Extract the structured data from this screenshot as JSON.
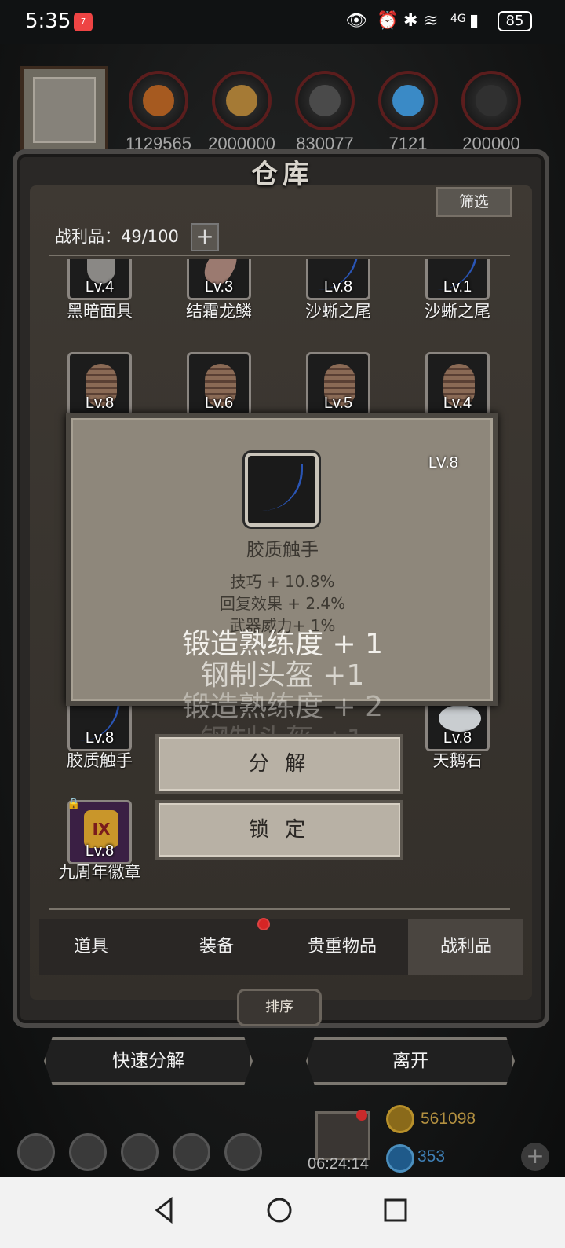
{
  "status_bar": {
    "time": "5:35",
    "app_badge": "7",
    "battery": "85",
    "signal": "4G"
  },
  "resources": {
    "values": [
      "1129565",
      "2000000",
      "830077",
      "7121",
      "200000"
    ]
  },
  "window": {
    "title": "仓库",
    "filter_label": "筛选",
    "loot_count": "战利品：49/100"
  },
  "items_row1": [
    {
      "level": "Lv.4",
      "name": "黑暗面具",
      "icon": "mask-icon"
    },
    {
      "level": "Lv.3",
      "name": "结霜龙鳞",
      "icon": "scale-icon"
    },
    {
      "level": "Lv.8",
      "name": "沙蜥之尾",
      "icon": "tail-icon"
    },
    {
      "level": "Lv.1",
      "name": "沙蜥之尾",
      "icon": "tail-icon"
    }
  ],
  "items_row2": [
    {
      "level": "Lv.8",
      "icon": "shell-icon"
    },
    {
      "level": "Lv.6",
      "icon": "shell-icon"
    },
    {
      "level": "Lv.5",
      "icon": "shell-icon"
    },
    {
      "level": "Lv.4",
      "icon": "shell-icon"
    }
  ],
  "items_row_bottom": [
    {
      "level": "Lv.8",
      "name": "胶质触手",
      "icon": "tail-icon"
    },
    {
      "level": "Lv.8",
      "name": "天鹅石",
      "icon": "stone-icon"
    }
  ],
  "badge_item": {
    "level": "Lv.8",
    "name": "九周年徽章",
    "badge_text": "IX"
  },
  "tooltip": {
    "level": "LV.8",
    "name": "胶质触手",
    "stats": [
      "技巧 + 10.8%",
      "回复效果 + 2.4%",
      "武器威力+ 1%"
    ]
  },
  "floating_texts": [
    "锻造熟练度 + 1",
    "钢制头盔 +1",
    "锻造熟练度 + 2",
    "钢制头盔 +1"
  ],
  "actions": {
    "decompose": "分 解",
    "lock": "锁 定"
  },
  "tabs": [
    "道具",
    "装备",
    "贵重物品",
    "战利品"
  ],
  "sort_label": "排序",
  "bottom_buttons": {
    "quick_decompose": "快速分解",
    "leave": "离开"
  },
  "hud": {
    "timer": "06:24:14",
    "gold": "561098",
    "gems": "353"
  },
  "colors": {
    "tooltip_bg": "#8e877b",
    "button_bg": "#b8b1a5",
    "badge_red": "#d62525",
    "gold_text": "#b39040",
    "gem_text": "#3f7fb5"
  }
}
